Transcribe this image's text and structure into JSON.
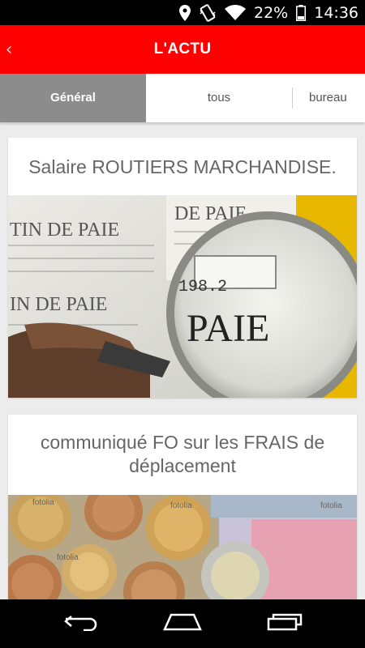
{
  "status_bar": {
    "battery_percent": "22%",
    "time": "14:36"
  },
  "app_bar": {
    "back_glyph": "‹",
    "title": "L'ACTU"
  },
  "tabs": [
    {
      "label": "Général",
      "active": true
    },
    {
      "label": "tous",
      "active": false
    },
    {
      "label": "bureau",
      "active": false
    }
  ],
  "articles": [
    {
      "title": "Salaire ROUTIERS MARCHANDISE.",
      "image_text": [
        "TIN DE PAIE",
        "DE PAIE",
        "IN DE PAIE",
        "198.2",
        "PAIE"
      ]
    },
    {
      "title": "communiqué FO sur les FRAIS de déplacement",
      "image_text": [
        "fotolia",
        "fotolia",
        "fotolia",
        "fotolia"
      ]
    }
  ],
  "colors": {
    "accent": "#ff0000",
    "active_tab": "#8c8c8c"
  }
}
